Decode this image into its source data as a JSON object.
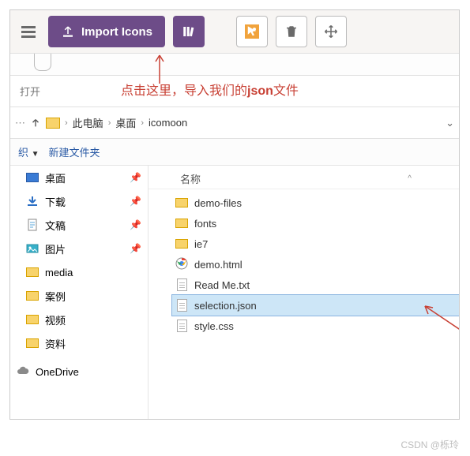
{
  "toolbar": {
    "import_label": "Import Icons"
  },
  "open_label": "打开",
  "annotation": {
    "prefix": "点击这里，导入我们的",
    "json_word": "json",
    "suffix": "文件"
  },
  "breadcrumb": {
    "root": "此电脑",
    "mid": "桌面",
    "leaf": "icomoon"
  },
  "toolbar2": {
    "organize": "织",
    "new_folder": "新建文件夹"
  },
  "column_header": "名称",
  "nav": [
    {
      "icon": "desktop",
      "label": "桌面",
      "pinned": true
    },
    {
      "icon": "download",
      "label": "下载",
      "pinned": true
    },
    {
      "icon": "document",
      "label": "文稿",
      "pinned": true
    },
    {
      "icon": "picture",
      "label": "图片",
      "pinned": true
    },
    {
      "icon": "folder",
      "label": "media",
      "pinned": false
    },
    {
      "icon": "folder",
      "label": "案例",
      "pinned": false
    },
    {
      "icon": "folder",
      "label": "视频",
      "pinned": false
    },
    {
      "icon": "folder",
      "label": "资料",
      "pinned": false
    }
  ],
  "nav_onedrive": "OneDrive",
  "files": [
    {
      "icon": "folder",
      "name": "demo-files",
      "selected": false
    },
    {
      "icon": "folder",
      "name": "fonts",
      "selected": false
    },
    {
      "icon": "folder",
      "name": "ie7",
      "selected": false
    },
    {
      "icon": "chrome",
      "name": "demo.html",
      "selected": false
    },
    {
      "icon": "txt",
      "name": "Read Me.txt",
      "selected": false
    },
    {
      "icon": "json",
      "name": "selection.json",
      "selected": true
    },
    {
      "icon": "css",
      "name": "style.css",
      "selected": false
    }
  ],
  "watermark": "CSDN @栎玲"
}
